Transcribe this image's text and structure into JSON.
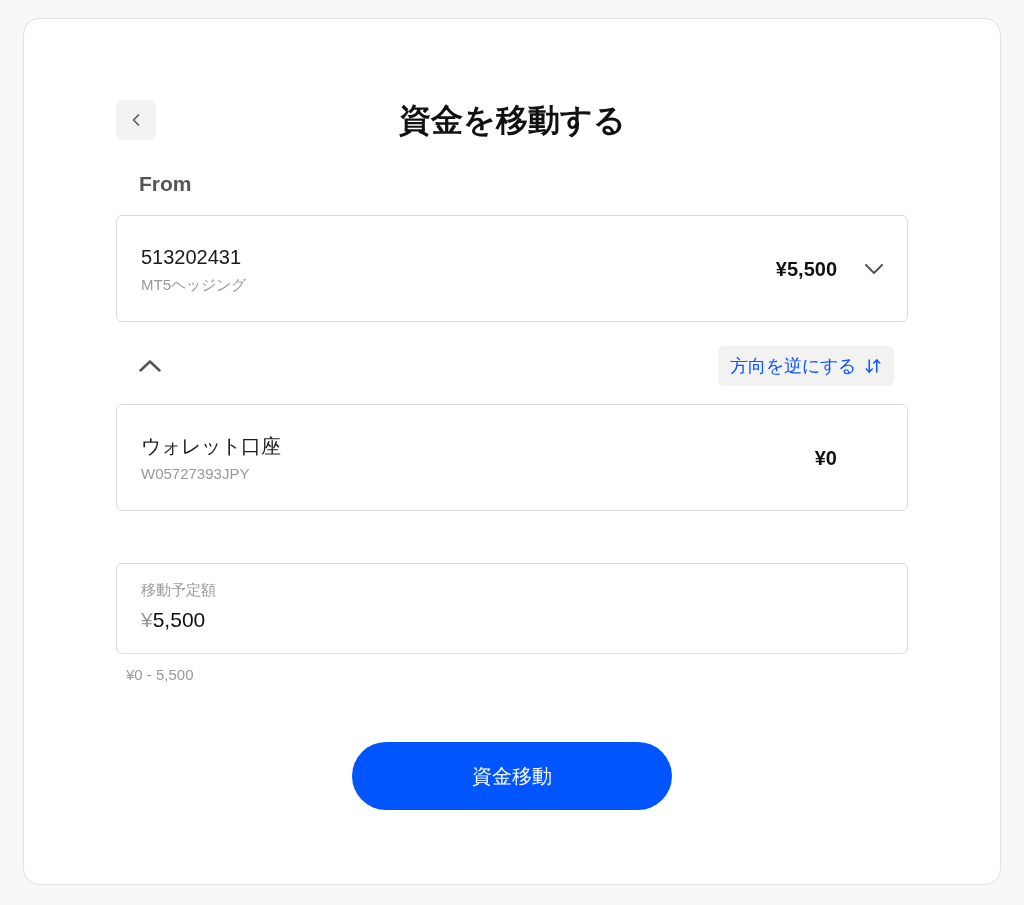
{
  "title": "資金を移動する",
  "from_label": "From",
  "from_account": {
    "number": "513202431",
    "type": "MT5ヘッジング",
    "balance": "¥5,500"
  },
  "reverse_button": "方向を逆にする",
  "to_account": {
    "number": "ウォレット口座",
    "type": "W05727393JPY",
    "balance": "¥0"
  },
  "amount_field": {
    "label": "移動予定額",
    "currency": "¥",
    "value": "5,500"
  },
  "range_hint": "¥0 - 5,500",
  "submit_button": "資金移動"
}
